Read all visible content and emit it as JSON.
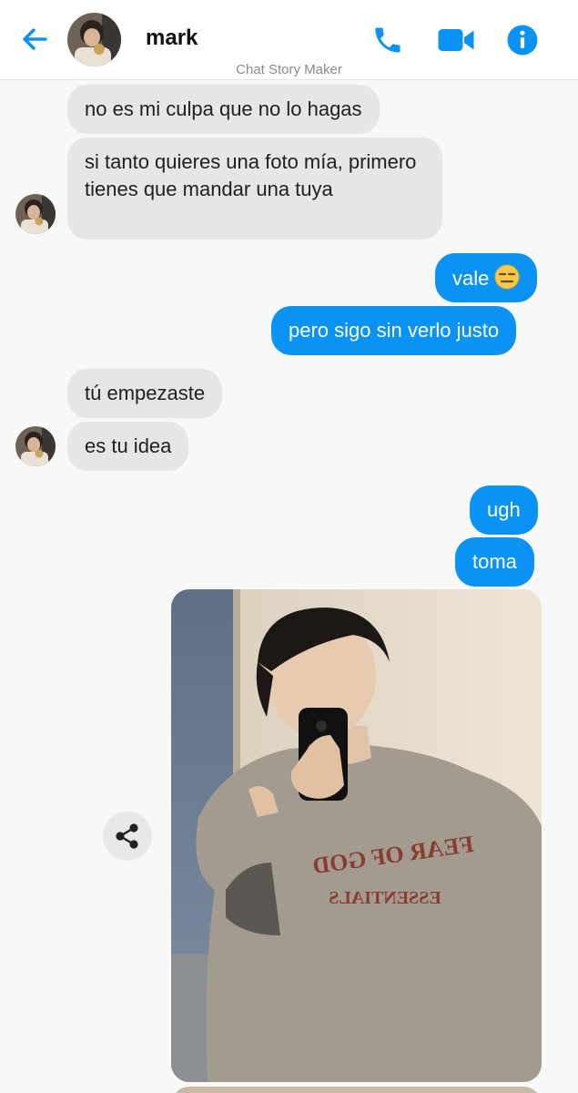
{
  "header": {
    "contact_name": "mark",
    "watermark": "Chat Story Maker"
  },
  "colors": {
    "accent": "#0a93f5",
    "incoming_bubble": "#e6e6e8",
    "background": "#f8f8f9"
  },
  "icons": {
    "back": "arrow-left-icon",
    "call": "phone-icon",
    "video": "video-camera-icon",
    "info": "info-icon",
    "share": "share-icon"
  },
  "messages": [
    {
      "from": "mark",
      "text": "no es mi culpa que no lo hagas"
    },
    {
      "from": "mark",
      "text": "si tanto quieres una foto mía, primero tienes que mandar una tuya"
    },
    {
      "from": "me",
      "text": "vale",
      "emoji": "expressionless-face"
    },
    {
      "from": "me",
      "text": "pero sigo sin verlo justo"
    },
    {
      "from": "mark",
      "text": "tú empezaste"
    },
    {
      "from": "mark",
      "text": "es tu idea"
    },
    {
      "from": "me",
      "text": "ugh"
    },
    {
      "from": "me",
      "text": "toma"
    },
    {
      "from": "me",
      "type": "photo",
      "photo_text": [
        "FEAR OF GOD",
        "ESSENTIALS"
      ]
    }
  ]
}
